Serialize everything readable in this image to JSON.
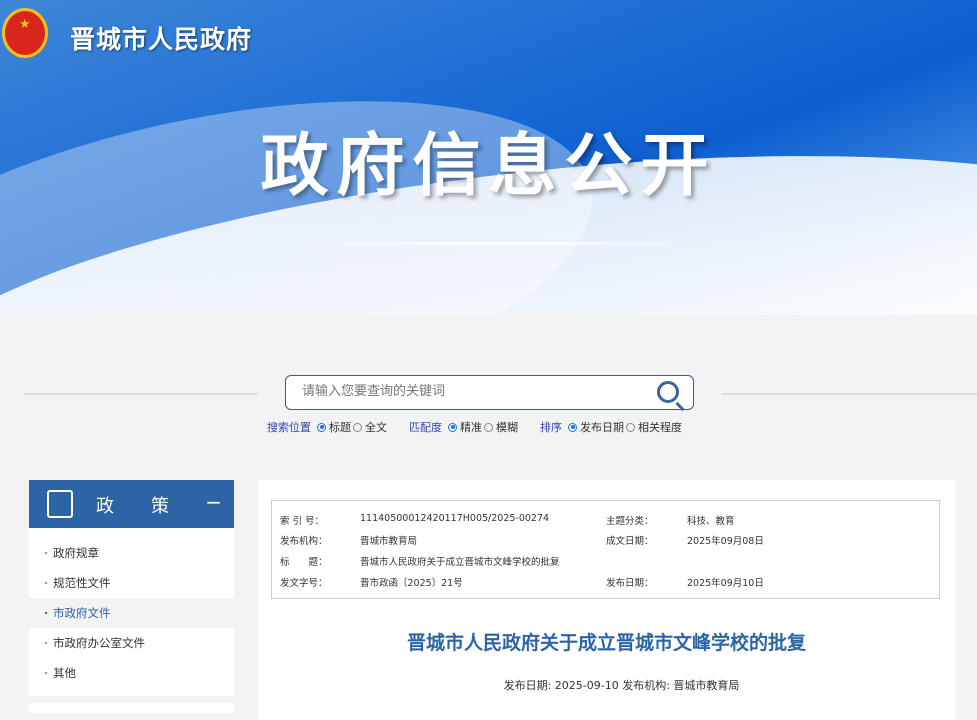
{
  "header": {
    "site_name": "晋城市人民政府",
    "banner_title": "政府信息公开"
  },
  "search": {
    "placeholder": "请输入您要查询的关键词",
    "groups": [
      {
        "label": "搜索位置",
        "options": [
          "标题",
          "全文"
        ],
        "selected": 0
      },
      {
        "label": "匹配度",
        "options": [
          "精准",
          "模糊"
        ],
        "selected": 0
      },
      {
        "label": "排序",
        "options": [
          "发布日期",
          "相关程度"
        ],
        "selected": 0
      }
    ]
  },
  "sidebar": {
    "title_a": "政",
    "title_b": "策",
    "collapse": "−",
    "items": [
      {
        "label": "政府规章"
      },
      {
        "label": "规范性文件"
      },
      {
        "label": "市政府文件",
        "active": true
      },
      {
        "label": "市政府办公室文件"
      },
      {
        "label": "其他"
      }
    ]
  },
  "info": {
    "index_label": "索 引 号：",
    "index": "11140500012420117H005/2025-00274",
    "topic_label": "主题分类：",
    "topic": "科技、教育",
    "org_label": "发布机构：",
    "org": "晋城市教育局",
    "written_label": "成文日期：",
    "written": "2025年09月08日",
    "title_label": "标　　题：",
    "title": "晋城市人民政府关于成立晋城市文峰学校的批复",
    "docno_label": "发文字号：",
    "docno": "晋市政函〔2025〕21号",
    "pub_label": "发布日期：",
    "pub": "2025年09月10日"
  },
  "document": {
    "title": "晋城市人民政府关于成立晋城市文峰学校的批复",
    "meta": "发布日期: 2025-09-10 发布机构: 晋城市教育局"
  }
}
